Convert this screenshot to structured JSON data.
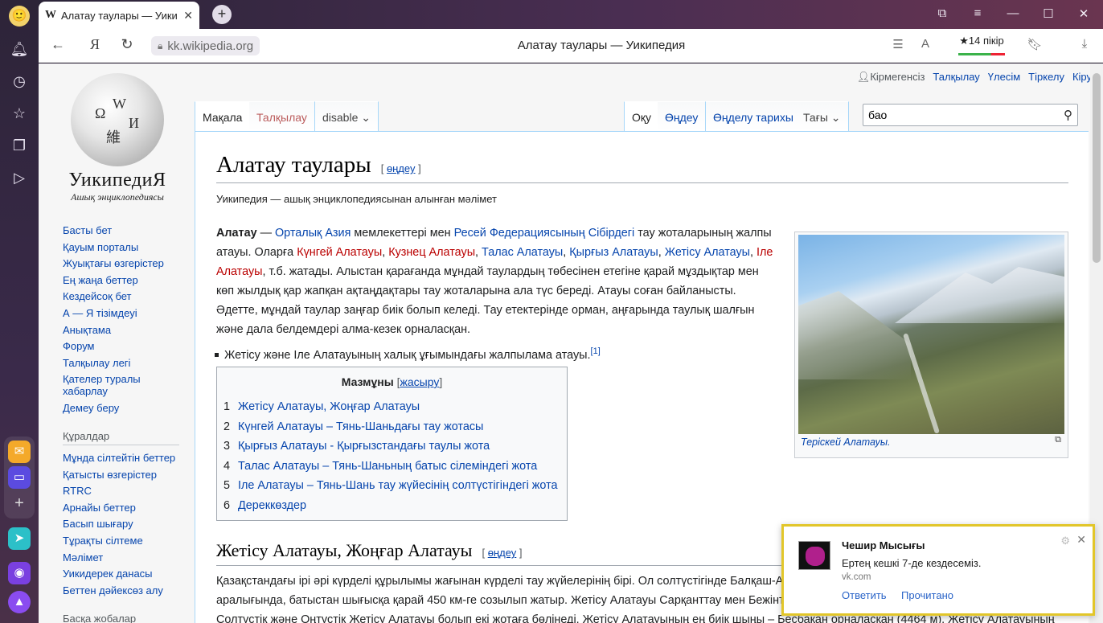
{
  "browser": {
    "tab_title": "Алатау таулары — Уикипедия",
    "tab_favicon": "W",
    "url": "kk.wikipedia.org",
    "page_title": "Алатау таулары — Уикипедия",
    "rating_label": "★14 пікір",
    "rating_fraction_good": 0.7
  },
  "logo": {
    "wordmark": "УикипедиЯ",
    "tagline": "Ашық энциклопедиясы",
    "globe_glyphs": [
      "Ω",
      "W",
      "И",
      "維"
    ]
  },
  "personal": {
    "anon": "Кірмегенсіз",
    "links": [
      "Талқылау",
      "Үлесім",
      "Тіркелу",
      "Кіру"
    ]
  },
  "tabs": {
    "article": "Мақала",
    "talk": "Талқылау",
    "variant": "disable",
    "read": "Оқу",
    "edit": "Өңдеу",
    "history": "Өңделу тарихы",
    "more": "Тағы"
  },
  "search": {
    "value": "бао"
  },
  "sidebar": {
    "main": [
      "Басты бет",
      "Қауым порталы",
      "Жуықтағы өзгерістер",
      "Ең жаңа беттер",
      "Кездейсоқ бет",
      "А — Я тізімдеуі",
      "Анықтама",
      "Форум",
      "Талқылау легі",
      "Қателер туралы хабарлау",
      "Демеу беру"
    ],
    "tools_heading": "Құралдар",
    "tools": [
      "Мұнда сілтейтін беттер",
      "Қатысты өзгерістер",
      "RTRC",
      "Арнайы беттер",
      "Басып шығару",
      "Тұрақты сілтеме",
      "Мәлімет",
      "Уикидерек данасы",
      "Беттен дәйексөз алу"
    ],
    "other_heading": "Басқа жобалар"
  },
  "article": {
    "title": "Алатау таулары",
    "edit_link": "өңдеу",
    "from": "Уикипедия — ашық энциклопедиясынан алынған мәлімет",
    "lead": {
      "bold": "Алатау",
      "t1": " — ",
      "l1": "Орталық Азия",
      "t2": " мемлекеттері мен ",
      "l2": "Ресей Федерациясының Сібірдегі",
      "t3": " тау жоталарының жалпы атауы. Оларға ",
      "r1": "Күнгей Алатауы",
      "c1": ", ",
      "r2": "Кузнец Алатауы",
      "c2": ", ",
      "l3": "Талас Алатауы",
      "c3": ", ",
      "l4": "Қырғыз Алатауы",
      "c4": ", ",
      "l5": "Жетісу Алатауы",
      "c5": ", ",
      "r3": "Іле Алатауы",
      "t4": ", т.б. жатады. Алыстан қарағанда мұндай таулардың төбесінен етегіне қарай мұздықтар мен көп жылдық қар жапқан ақтаңдақтары тау жоталарына ала түс береді. Атауы соған байланысты. Әдетте, мұндай таулар заңғар биік болып келеді. Тау етектерінде орман, аңғарында таулық шалғын және дала белдемдері алма-кезек орналасқан."
    },
    "bullet": "Жетісу және Іле Алатауының халық ұғымындағы жалпылама атауы.",
    "bullet_ref": "[1]",
    "toc": {
      "title": "Мазмұны",
      "hide": "жасыру",
      "items": [
        {
          "n": "1",
          "t": "Жетісу Алатауы, Жоңғар Алатауы"
        },
        {
          "n": "2",
          "t": "Күнгей Алатауы – Тянь-Шаньдағы тау жотасы"
        },
        {
          "n": "3",
          "t": "Қырғыз Алатауы - Қырғызстандағы таулы жота"
        },
        {
          "n": "4",
          "t": "Талас Алатауы – Тянь-Шаньның батыс сілеміндегі жота"
        },
        {
          "n": "5",
          "t": "Іле Алатауы – Тянь-Шань тау жүйесінің солтүстігіндегі жота"
        },
        {
          "n": "6",
          "t": "Дереккөздер"
        }
      ]
    },
    "image_caption": "Терiскей Алатауы.",
    "section1_title": "Жетісу Алатауы, Жоңғар Алатауы",
    "section1_text": "Қазақстандағы ірі әрі күрделі құрылымы жағынан күрделі тау жүйелерінің бірі. Ол солтүстігінде Балқаш-Алакөл ойысы мен оңтүстігінде Іле өзенінің аралығында, батыстан шығысқа қарай 450 км-ге созылып жатыр. Жетісу Алатауы Сарқанттау мен Бежінтаудың шығысындағы Тентек өзенінің аңғары арқылы Солтүстік және Оңтүстік Жетісу Алатауы болып екі жотаға бөлінеді. Жетісу Алатауының ең биік шыңы – Бесбақан орналасқан (4464 м). Жетісу Алатауының"
  },
  "notification": {
    "from": "Чешир Мысығы",
    "message": "Ертең кешкі 7-де кездесеміз.",
    "source": "vk.com",
    "reply": "Ответить",
    "read": "Прочитано"
  },
  "colors": {
    "link": "#0645ad",
    "redlink": "#ba0000",
    "notif_border": "#e2c62a"
  }
}
